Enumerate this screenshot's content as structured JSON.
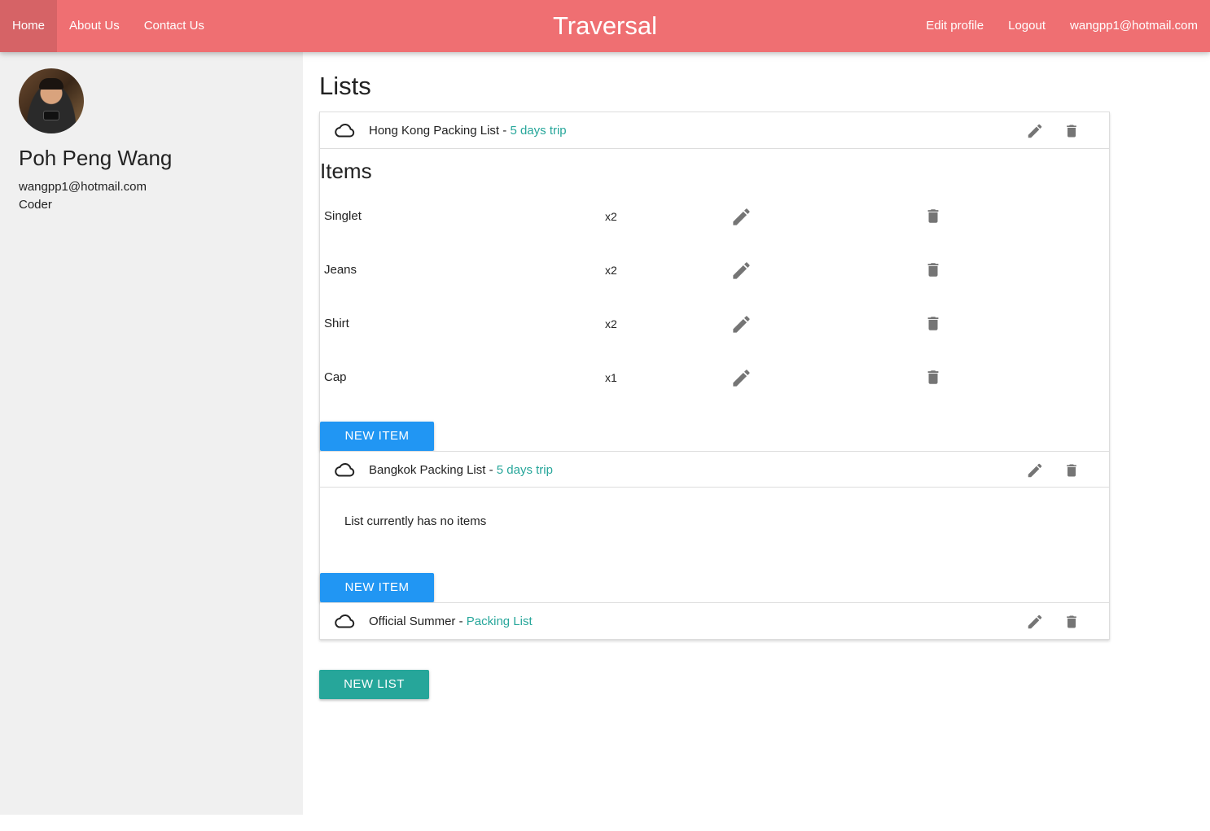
{
  "nav": {
    "home": "Home",
    "about": "About Us",
    "contact": "Contact Us",
    "brand": "Traversal",
    "edit_profile": "Edit profile",
    "logout": "Logout",
    "user_email": "wangpp1@hotmail.com"
  },
  "profile": {
    "name": "Poh Peng Wang",
    "email": "wangpp1@hotmail.com",
    "role": "Coder"
  },
  "page_title": "Lists",
  "lists": [
    {
      "name": "Hong Kong Packing List",
      "separator": " - ",
      "subtitle": "5 days trip",
      "items_heading": "Items",
      "items": [
        {
          "name": "Singlet",
          "qty": "x2"
        },
        {
          "name": "Jeans",
          "qty": "x2"
        },
        {
          "name": "Shirt",
          "qty": "x2"
        },
        {
          "name": "Cap",
          "qty": "x1"
        }
      ],
      "new_item_label": "NEW ITEM"
    },
    {
      "name": "Bangkok Packing List",
      "separator": " - ",
      "subtitle": "5 days trip",
      "empty_message": "List currently has no items",
      "new_item_label": "NEW ITEM"
    },
    {
      "name": "Official Summer",
      "separator": " - ",
      "subtitle": "Packing List"
    }
  ],
  "new_list_label": "NEW LIST",
  "icons": {
    "list_icon": "cloud-icon",
    "edit_icon": "pencil-icon",
    "delete_icon": "trash-icon"
  },
  "colors": {
    "navbar": "#ef6f72",
    "accent_teal": "#26a69a",
    "button_blue": "#2196f3",
    "sidebar_bg": "#f0f0f0",
    "icon_gray": "#757575"
  }
}
